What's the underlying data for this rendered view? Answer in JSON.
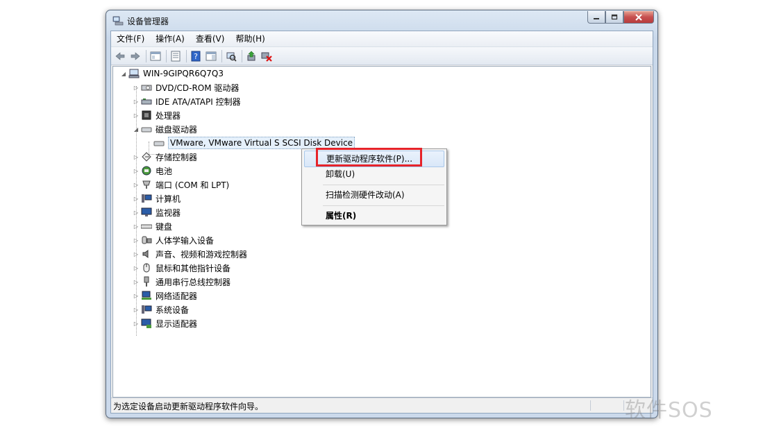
{
  "window": {
    "title": "设备管理器"
  },
  "menu": [
    "文件(F)",
    "操作(A)",
    "查看(V)",
    "帮助(H)"
  ],
  "toolbar_icons": [
    "back-icon",
    "forward-icon",
    "show-hide-tree-icon",
    "properties-icon",
    "help-icon",
    "action-pane-icon",
    "scan-hardware-icon",
    "update-driver-icon",
    "uninstall-icon"
  ],
  "tree": {
    "root": "WIN-9GIPQR6Q7Q3",
    "items": [
      {
        "label": "DVD/CD-ROM 驱动器",
        "icon": "dvd-drive-icon",
        "expanded": false
      },
      {
        "label": "IDE ATA/ATAPI 控制器",
        "icon": "ide-controller-icon",
        "expanded": false
      },
      {
        "label": "处理器",
        "icon": "processor-icon",
        "expanded": false
      },
      {
        "label": "磁盘驱动器",
        "icon": "disk-drive-icon",
        "expanded": true
      },
      {
        "label": "VMware, VMware Virtual S SCSI Disk Device",
        "icon": "disk-icon",
        "child": true,
        "selected": true
      },
      {
        "label": "存储控制器",
        "icon": "storage-controller-icon",
        "expanded": false
      },
      {
        "label": "电池",
        "icon": "battery-icon",
        "expanded": false
      },
      {
        "label": "端口 (COM 和 LPT)",
        "icon": "port-icon",
        "expanded": false
      },
      {
        "label": "计算机",
        "icon": "computer-icon",
        "expanded": false
      },
      {
        "label": "监视器",
        "icon": "monitor-icon",
        "expanded": false
      },
      {
        "label": "键盘",
        "icon": "keyboard-icon",
        "expanded": false
      },
      {
        "label": "人体学输入设备",
        "icon": "hid-icon",
        "expanded": false
      },
      {
        "label": "声音、视频和游戏控制器",
        "icon": "sound-icon",
        "expanded": false
      },
      {
        "label": "鼠标和其他指针设备",
        "icon": "mouse-icon",
        "expanded": false
      },
      {
        "label": "通用串行总线控制器",
        "icon": "usb-icon",
        "expanded": false
      },
      {
        "label": "网络适配器",
        "icon": "network-adapter-icon",
        "expanded": false
      },
      {
        "label": "系统设备",
        "icon": "system-device-icon",
        "expanded": false
      },
      {
        "label": "显示适配器",
        "icon": "display-adapter-icon",
        "expanded": false
      }
    ]
  },
  "context_menu": {
    "update_driver": "更新驱动程序软件(P)...",
    "uninstall": "卸载(U)",
    "scan": "扫描检测硬件改动(A)",
    "properties": "属性(R)"
  },
  "status": {
    "text": "为选定设备启动更新驱动程序软件向导。"
  },
  "watermark": "软件SOS",
  "colors": {
    "highlight_box": "#e6232a",
    "selection": "#e5f0fb"
  }
}
